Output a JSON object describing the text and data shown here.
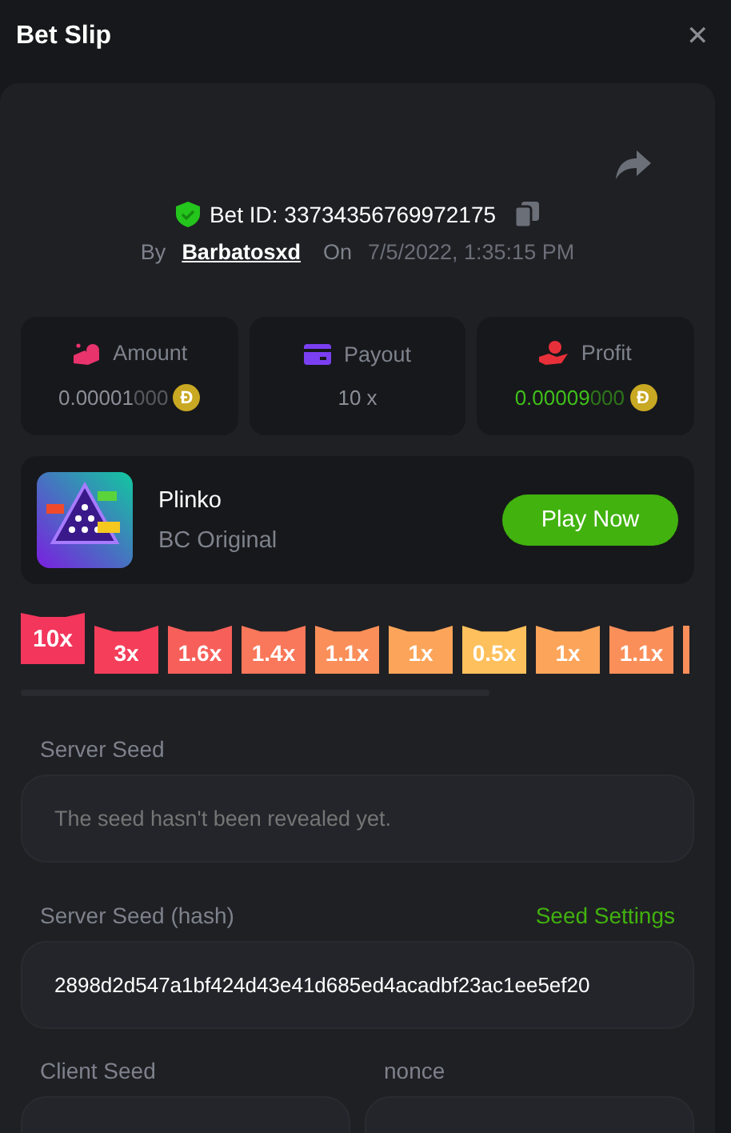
{
  "window": {
    "title": "Bet Slip",
    "close": "✕"
  },
  "bet": {
    "id_label": "Bet ID:",
    "id": "33734356769972175",
    "verified": true,
    "by_label": "By",
    "user": "Barbatosxd",
    "on_label": "On",
    "date": "7/5/2022, 1:35:15 PM"
  },
  "stats": [
    {
      "kind": "amount",
      "label": "Amount",
      "value": "0.00001",
      "zeros": "000",
      "coin": "Đ"
    },
    {
      "kind": "payout",
      "label": "Payout",
      "value": "10 x"
    },
    {
      "kind": "profit",
      "label": "Profit",
      "value": "0.00009",
      "zeros": "000",
      "coin": "Đ"
    }
  ],
  "game": {
    "kind": "picture",
    "name": "Plinko",
    "provider": "BC Original",
    "button": "Play Now"
  },
  "buckets": [
    {
      "label": "10x",
      "selected": true,
      "color": "#f3365c"
    },
    {
      "label": "3x",
      "selected": false,
      "color": "#f43e5a"
    },
    {
      "label": "1.6x",
      "selected": false,
      "color": "#f7605a"
    },
    {
      "label": "1.4x",
      "selected": false,
      "color": "#f9775a"
    },
    {
      "label": "1.1x",
      "selected": false,
      "color": "#fa8f5a"
    },
    {
      "label": "1x",
      "selected": false,
      "color": "#fca55a"
    },
    {
      "label": "0.5x",
      "selected": false,
      "color": "#fec05c"
    },
    {
      "label": "1x",
      "selected": false,
      "color": "#fca55a"
    },
    {
      "label": "1.1x",
      "selected": false,
      "color": "#fa8f5a"
    }
  ],
  "server_seed": {
    "label": "Server Seed",
    "placeholder": "The seed hasn't been revealed yet."
  },
  "server_seed_hash": {
    "label": "Server Seed (hash)",
    "link": "Seed Settings",
    "value": "2898d2d547a1bf424d43e41d685ed4acadbf23ac1ee5ef20"
  },
  "client_seed": {
    "label": "Client Seed"
  },
  "nonce": {
    "label": "nonce"
  }
}
